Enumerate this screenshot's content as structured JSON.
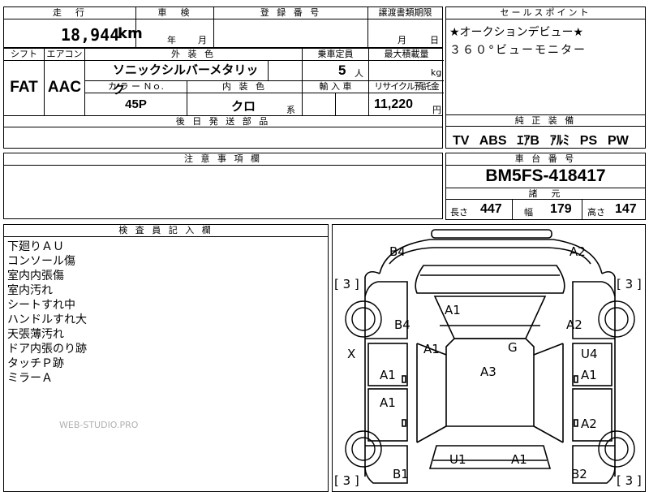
{
  "header": {
    "mileage_label": "走　行",
    "inspection_label": "車　検",
    "registration_label": "登 録 番 号",
    "transfer_label": "譲渡書類期限",
    "sales_point_label": "セールスポイント",
    "mileage_value": "18,944",
    "mileage_unit": "km",
    "year_unit": "年",
    "month_unit": "月",
    "day_unit": "日"
  },
  "specs": {
    "shift_label": "シフト",
    "aircon_label": "エアコン",
    "exterior_label": "外 装 色",
    "capacity_label": "乗車定員",
    "maxload_label": "最大積載量",
    "shift_value": "FAT",
    "aircon_value": "AAC",
    "exterior_value": "ソニックシルバーメタリック",
    "capacity_value": "5",
    "capacity_unit": "人",
    "maxload_unit": "kg",
    "color_no_label": "カ ラ ー Ｎｏ.",
    "interior_label": "内 装 色",
    "import_label": "輸 入 車",
    "recycle_label": "リサイクル預託金",
    "color_no_value": "45P",
    "interior_value": "クロ",
    "interior_suffix": "系",
    "recycle_value": "11,220",
    "recycle_unit": "円",
    "later_parts_label": "後 日 発 送 部 品"
  },
  "sales_point": {
    "line1": "★オークションデビュー★",
    "line2": "３６０°ビューモニター"
  },
  "equipment": {
    "label": "純 正 装 備",
    "items": [
      "TV",
      "ABS",
      "ｴｱB",
      "ｱﾙﾐ",
      "PS",
      "PW"
    ]
  },
  "notes": {
    "label": "注 意 事 項 欄"
  },
  "chassis": {
    "label": "車 台 番 号",
    "value": "BM5FS-418417",
    "dims_label": "諸　元",
    "length_label": "長さ",
    "length_value": "447",
    "width_label": "幅",
    "width_value": "179",
    "height_label": "高さ",
    "height_value": "147"
  },
  "inspector": {
    "label": "検 査 員 記 入 欄",
    "lines": [
      "下廻りＡＵ",
      "コンソール傷",
      "室内内張傷",
      "室内汚れ",
      "シートすれ中",
      "ハンドルすれ大",
      "天張薄汚れ",
      "ドア内張のり跡",
      "タッチＰ跡",
      "ミラーＡ"
    ],
    "watermark": "WEB-STUDIO.PRO"
  },
  "diagram": {
    "marks": [
      "B4",
      "A2",
      "A1",
      "B4",
      "A2",
      "A1",
      "G",
      "A3",
      "X",
      "U4",
      "A1",
      "A1",
      "A1",
      "A2",
      "U1",
      "A1",
      "B1",
      "B2"
    ],
    "bracket": "[ 3 ]"
  }
}
